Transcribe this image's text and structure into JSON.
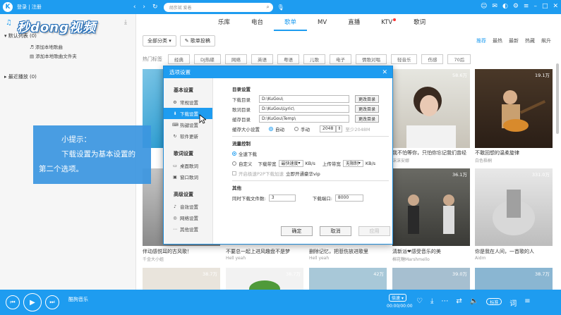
{
  "app": {
    "logo_letter": "K",
    "login": "登录 | 注册",
    "search_placeholder": "胡彦斌 爱着",
    "watermark": "秒dong视频"
  },
  "nav_tabs": [
    {
      "label": "乐库",
      "active": false
    },
    {
      "label": "电台",
      "active": false
    },
    {
      "label": "歌单",
      "active": true
    },
    {
      "label": "MV",
      "active": false
    },
    {
      "label": "直播",
      "active": false
    },
    {
      "label": "KTV",
      "active": false
    },
    {
      "label": "歌词",
      "active": false
    }
  ],
  "sidebar": {
    "default_list": "默认列表",
    "default_count": "(0)",
    "add_local": "添加本地歌曲",
    "add_folder": "添加本地歌曲文件夹",
    "recent": "最近播放",
    "recent_count": "(0)"
  },
  "filter": {
    "category_btn": "全部分类",
    "upload_btn": "歌单投稿",
    "sort": [
      "推荐",
      "最热",
      "最新",
      "热藏",
      "飙升"
    ],
    "hot_label": "热门标签",
    "tags": [
      "经典",
      "DJ热碟",
      "网络",
      "英语",
      "粤语",
      "儿歌",
      "电子",
      "情歌对唱",
      "轻音乐",
      "伤感",
      "70后"
    ]
  },
  "cards": [
    {
      "plays": "58.6万",
      "title": "我不怕等你，只怕你忘记我们曾经",
      "sub": "沫沫安娜"
    },
    {
      "plays": "19.1万",
      "title": "不敢回想的温柔旋律",
      "sub": "白色梧桐"
    },
    {
      "plays": "",
      "title": "伴动感悦耳的古风歌！",
      "sub": "千金大小姐"
    },
    {
      "plays": "",
      "title": "不要总一起上进风趣盘不是梦",
      "sub": "Hell yeah"
    },
    {
      "plays": "",
      "title": "删除记忆，把悲伤放进歌里",
      "sub": "Hell yeah"
    },
    {
      "plays": "36.1万",
      "title": "清新派❤感受音乐的美",
      "sub": "棉花糖Marshmello"
    },
    {
      "plays": "331.0万",
      "title": "你是我在人间，一首歌的人",
      "sub": "Aidm"
    }
  ],
  "bottom_plays": [
    "38.7万",
    "38.7万",
    "42万",
    "39.0万",
    "38.7万",
    "67.6万"
  ],
  "dialog": {
    "title": "选项设置",
    "nav_groups": [
      {
        "label": "基本设置",
        "items": [
          {
            "label": "常规设置",
            "icon": "⚙",
            "selected": false
          },
          {
            "label": "下载设置",
            "icon": "⬇",
            "selected": true
          },
          {
            "label": "热键设置",
            "icon": "⌨",
            "selected": false
          },
          {
            "label": "软件更新",
            "icon": "↻",
            "selected": false
          }
        ]
      },
      {
        "label": "歌词设置",
        "items": [
          {
            "label": "桌面歌词",
            "icon": "▭",
            "selected": false
          },
          {
            "label": "窗口歌词",
            "icon": "▣",
            "selected": false
          }
        ]
      },
      {
        "label": "高级设置",
        "items": [
          {
            "label": "音效设置",
            "icon": "♪",
            "selected": false
          },
          {
            "label": "网络设置",
            "icon": "◎",
            "selected": false
          },
          {
            "label": "其他设置",
            "icon": "⋯",
            "selected": false
          }
        ]
      }
    ],
    "dir_section": "目录设置",
    "download_dir_label": "下载目录",
    "download_dir": "D:\\KuGou\\",
    "lyric_dir_label": "歌词目录",
    "lyric_dir": "D:\\KuGou\\Lyric\\",
    "cache_dir_label": "缓存目录",
    "cache_dir": "D:\\KuGou\\Temp\\",
    "change_dir": "更改目录",
    "cache_size_label": "缓存大小设置",
    "auto": "自动",
    "manual": "手动",
    "cache_size": "2048",
    "cache_hint": "至少2048M",
    "flow_section": "流量控制",
    "full_speed": "全速下载",
    "custom": "自定义",
    "download_bw_label": "下载带宽",
    "download_bw": "最快速度",
    "kbs": "KB/s",
    "upload_bw_label": "上传带宽",
    "upload_bw": "无限制",
    "p2p_option": "开启极速P2P下载加速",
    "vip_link": "立即开通豪华vip",
    "other_section": "其他",
    "max_tasks_label": "同时下载文件数:",
    "max_tasks": "3",
    "port_label": "下载端口:",
    "port": "8000",
    "ok": "确定",
    "cancel": "取消",
    "apply": "应用"
  },
  "tip": {
    "line1": "小提示：",
    "line2": "下载设置为基本设置的",
    "line3": "第二个选项。"
  },
  "player": {
    "title": "酷狗音乐",
    "speed": "倍速 ▾",
    "time": "00:00/00:00",
    "quality": "标准"
  }
}
